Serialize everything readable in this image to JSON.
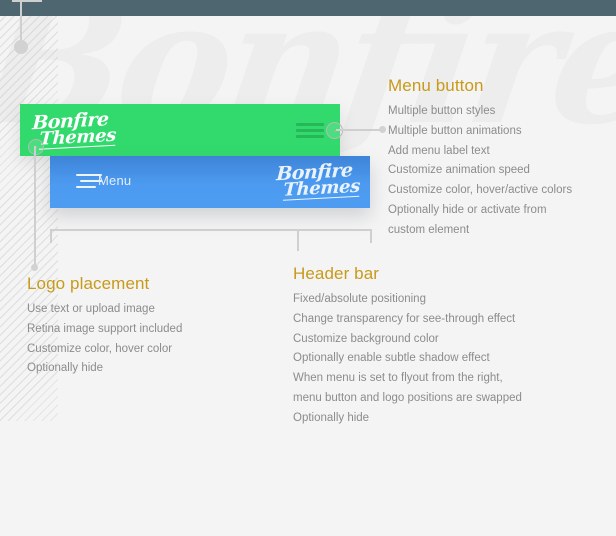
{
  "page": {
    "background_color": "#f4f4f4",
    "topbar_color": "#4d6670",
    "accent_heading_color": "#c89a1a",
    "body_text_color": "#8c8c8c",
    "watermark_text": "Bonfire"
  },
  "mockups": {
    "green_bar": {
      "background_color": "#32da6d",
      "logo_line1": "Bonfire",
      "logo_line2": "Themes",
      "menu_icon": "hamburger-icon"
    },
    "blue_bar": {
      "background_color": "#4c9bf0",
      "menu_icon": "hamburger-icon",
      "menu_label": "Menu",
      "logo_line1": "Bonfire",
      "logo_line2": "Themes"
    }
  },
  "callouts": [
    {
      "id": "menu-button",
      "title": "Menu button",
      "items": [
        "Multiple button styles",
        "Multiple button animations",
        "Add menu label text",
        "Customize animation speed",
        "Customize color, hover/active colors",
        "Optionally hide or activate from\ncustom element"
      ]
    },
    {
      "id": "logo-placement",
      "title": "Logo placement",
      "items": [
        "Use text or upload image",
        "Retina image support included",
        "Customize color, hover color",
        "Optionally hide"
      ]
    },
    {
      "id": "header-bar",
      "title": "Header bar",
      "items": [
        "Fixed/absolute positioning",
        "Change transparency for see-through effect",
        "Customize background color",
        "Optionally enable subtle shadow effect",
        "When menu is set to flyout from the right,\nmenu button and logo positions are swapped",
        "Optionally hide"
      ]
    }
  ]
}
